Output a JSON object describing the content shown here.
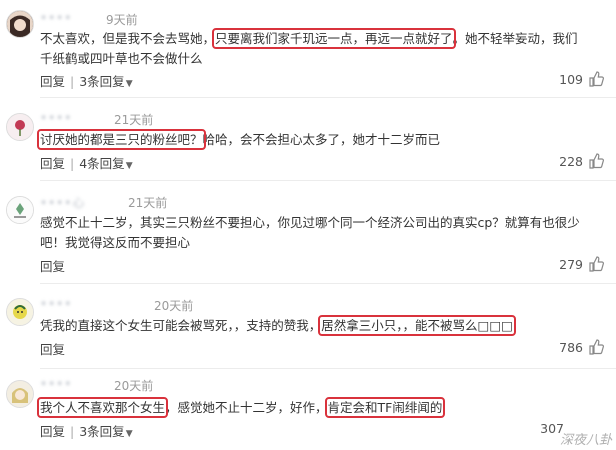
{
  "comments": [
    {
      "user": "••••",
      "time": "9天前",
      "text_parts": [
        {
          "t": "不太喜欢，但是我不会去骂她，",
          "hl": false
        },
        {
          "t": "只要离我们家千玑远一点，再远一点就好了",
          "hl": true
        },
        {
          "t": "。她不轻举妄动，我们千纸鹤或四叶草也不会做什么",
          "hl": false
        }
      ],
      "reply_label": "回复",
      "replies_label": "3条回复",
      "likes": "109"
    },
    {
      "user": "••••",
      "time": "21天前",
      "text_parts": [
        {
          "t": "讨厌她的都是三只的粉丝吧？",
          "hl": true
        },
        {
          "t": "哈哈，会不会担心太多了，她才十二岁而已",
          "hl": false
        }
      ],
      "reply_label": "回复",
      "replies_label": "4条回复",
      "likes": "228"
    },
    {
      "user": "••••心",
      "time": "21天前",
      "text_parts": [
        {
          "t": "感觉不止十二岁，其实三只粉丝不要担心，你见过哪个同一个经济公司出的真实cp？就算有也很少吧！我觉得这反而不要担心",
          "hl": false
        }
      ],
      "reply_label": "回复",
      "replies_label": "",
      "likes": "279"
    },
    {
      "user": "••••",
      "time": "20天前",
      "text_parts": [
        {
          "t": "凭我的直接这个女生可能会被骂死，，支持的赞我，",
          "hl": false
        },
        {
          "t": "居然拿三小只，，能不被骂么□□□",
          "hl": true
        }
      ],
      "reply_label": "回复",
      "replies_label": "",
      "likes": "786"
    },
    {
      "user": "••••",
      "time": "20天前",
      "text_parts": [
        {
          "t": "我个人不喜欢那个女生",
          "hl": true
        },
        {
          "t": "，感觉她不止十二岁，好作，",
          "hl": false
        },
        {
          "t": "肯定会和TF闹绯闻的",
          "hl": true
        }
      ],
      "reply_label": "回复",
      "replies_label": "3条回复",
      "likes": "307"
    }
  ],
  "watermark": "深夜八卦"
}
